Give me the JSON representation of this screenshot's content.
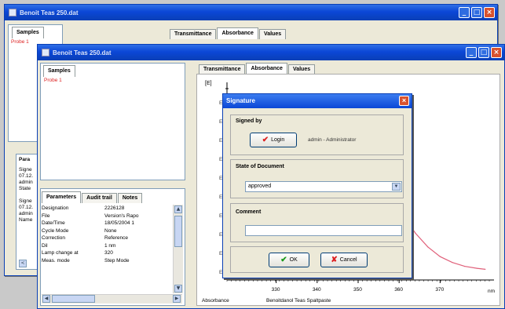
{
  "back_window": {
    "title": "Benoit Teas 250.dat",
    "samples_tab": "Samples",
    "sample_item": "Probe 1",
    "tabs": [
      "Transmittance",
      "Absorbance",
      "Values"
    ],
    "param_label": "Para",
    "params_lines": [
      "Signe",
      "07.12.",
      "admin",
      "State",
      "",
      "Signe",
      "07.12.",
      "admin",
      "Name"
    ],
    "scroll_left_button": "<"
  },
  "front_window": {
    "title": "Benoit Teas 250.dat",
    "samples_tab": "Samples",
    "sample_item": "Probe 1",
    "tabs": [
      "Transmittance",
      "Absorbance",
      "Values"
    ],
    "bottom_tabs": [
      "Parameters",
      "Audit trail",
      "Notes"
    ],
    "parameters": [
      {
        "key": "Designation",
        "value": "2226128"
      },
      {
        "key": "File",
        "value": "Version's Rapo"
      },
      {
        "key": "Date/Time",
        "value": "18/05/2004 1"
      },
      {
        "key": "Cycle Mode",
        "value": "None"
      },
      {
        "key": "Correction",
        "value": "Reference"
      },
      {
        "key": "Dil",
        "value": "1 nm"
      },
      {
        "key": "Lamp change at",
        "value": "320"
      },
      {
        "key": "Meas. mode",
        "value": "Step Mode"
      }
    ]
  },
  "chart_data": {
    "type": "line",
    "ylabel": "[E]",
    "xlabel": "Absorbance",
    "subtitle": "Benoitdanol Teas Spaltpaste",
    "x_unit": "nm",
    "x_ticks": [
      "330",
      "340",
      "350",
      "360",
      "370"
    ],
    "y_ticks": [
      "E",
      "E",
      "E",
      "E",
      "E",
      "E",
      "E",
      "E",
      "E",
      "E"
    ],
    "series": [
      {
        "x": [
          355,
          358,
          361,
          364,
          367,
          370,
          373,
          376,
          379,
          381
        ],
        "y": [
          0.6,
          0.45,
          0.33,
          0.24,
          0.17,
          0.12,
          0.09,
          0.07,
          0.06,
          0.055
        ]
      }
    ],
    "xlim": [
      318,
      382
    ],
    "ylim": [
      0,
      1
    ],
    "line_color": "#e0607a"
  },
  "dialog": {
    "title": "Signature",
    "signed_by_label": "Signed by",
    "login_button": "Login",
    "signed_user": "admin - Administrator",
    "state_label": "State of Document",
    "state_value": "approved",
    "comment_label": "Comment",
    "comment_value": "",
    "ok_button": "OK",
    "cancel_button": "Cancel"
  },
  "colors": {
    "titlebar": "#0b47d6",
    "dialog_bg": "#ece9d8",
    "sample_text": "#dd2222",
    "ok_check": "#1a9a1a",
    "cancel_x": "#d22222",
    "login_check": "#d22222"
  }
}
